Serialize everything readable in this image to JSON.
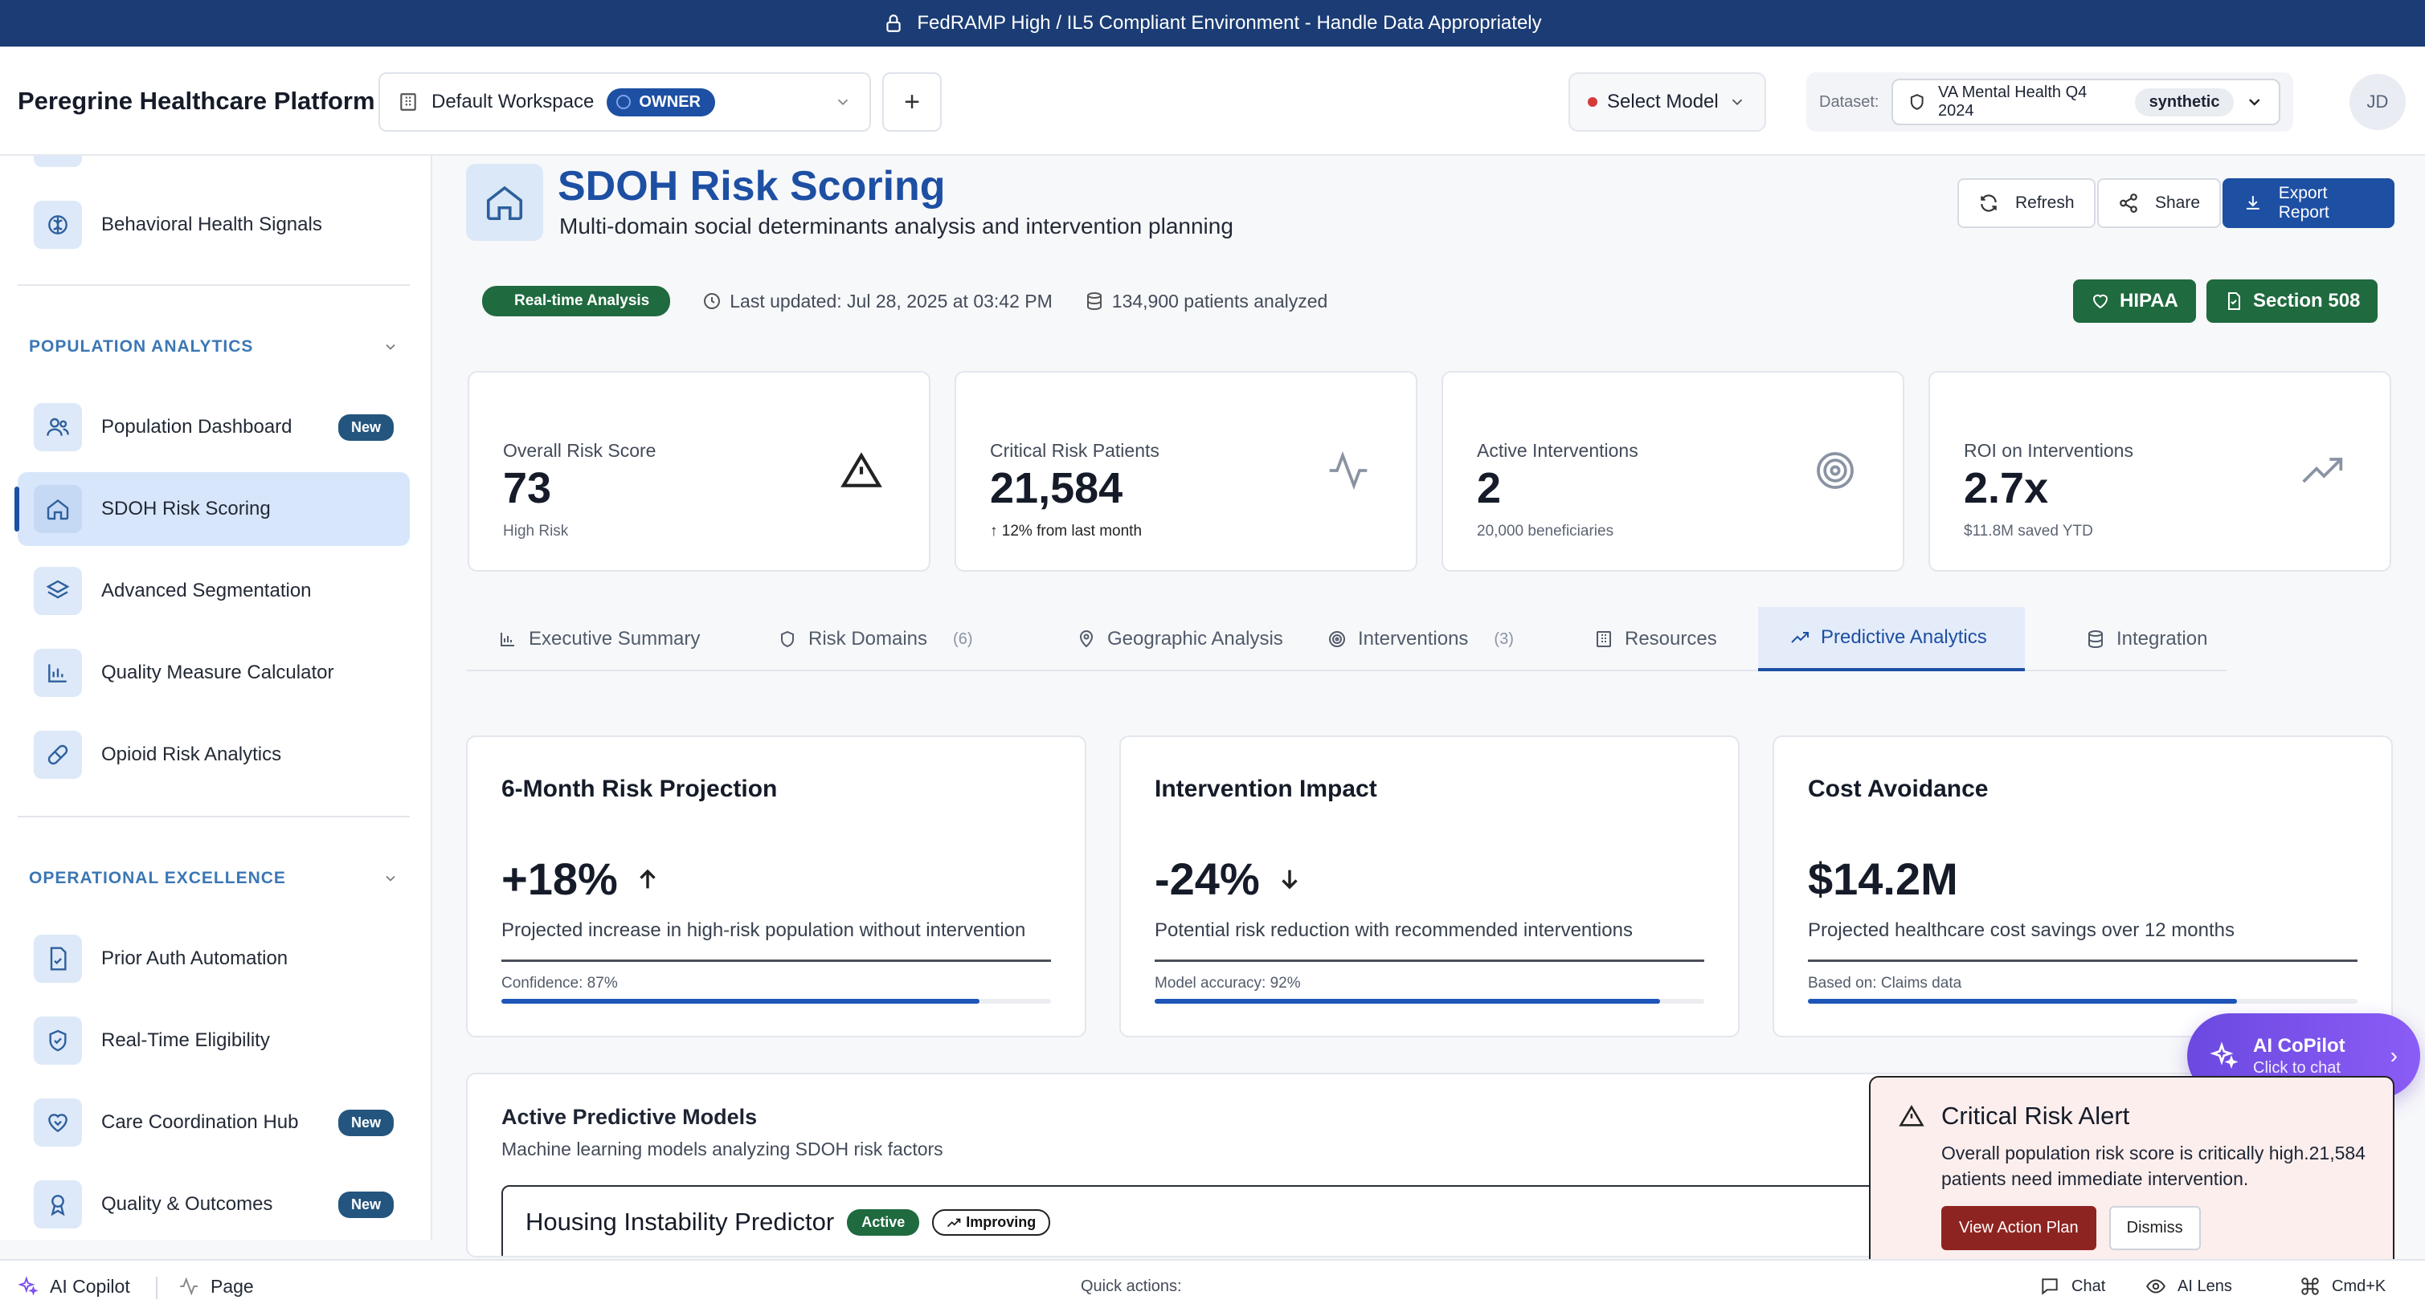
{
  "banner": {
    "text": "FedRAMP High / IL5 Compliant Environment - Handle Data Appropriately"
  },
  "header": {
    "brand": "Peregrine Healthcare Platform",
    "workspace": {
      "name": "Default Workspace",
      "role": "OWNER"
    },
    "add_label": "+",
    "model_select": "Select Model",
    "dataset": {
      "label": "Dataset:",
      "name": "VA Mental Health Q4 2024",
      "tag": "synthetic"
    },
    "avatar": "JD"
  },
  "sidebar": {
    "top_items": [
      {
        "label": "Behavioral Health Signals",
        "icon": "brain-icon"
      }
    ],
    "sections": [
      {
        "title": "POPULATION ANALYTICS",
        "items": [
          {
            "label": "Population Dashboard",
            "badge": "New",
            "icon": "users-icon"
          },
          {
            "label": "SDOH Risk Scoring",
            "badge": "",
            "icon": "home-icon",
            "active": true
          },
          {
            "label": "Advanced Segmentation",
            "badge": "",
            "icon": "layers-icon"
          },
          {
            "label": "Quality Measure Calculator",
            "badge": "",
            "icon": "bar-chart-icon"
          },
          {
            "label": "Opioid Risk Analytics",
            "badge": "",
            "icon": "pill-icon"
          }
        ]
      },
      {
        "title": "OPERATIONAL EXCELLENCE",
        "items": [
          {
            "label": "Prior Auth Automation",
            "badge": "",
            "icon": "file-check-icon"
          },
          {
            "label": "Real-Time Eligibility",
            "badge": "",
            "icon": "shield-check-icon"
          },
          {
            "label": "Care Coordination Hub",
            "badge": "New",
            "icon": "heart-handshake-icon"
          },
          {
            "label": "Quality & Outcomes",
            "badge": "New",
            "icon": "award-icon"
          }
        ]
      }
    ]
  },
  "page": {
    "title": "SDOH Risk Scoring",
    "subtitle": "Multi-domain social determinants analysis and intervention planning",
    "actions": {
      "refresh": "Refresh",
      "share": "Share",
      "export": "Export Report"
    },
    "meta": {
      "realtime": "Real-time Analysis",
      "updated": "Last updated: Jul 28, 2025 at 03:42 PM",
      "patients": "134,900 patients analyzed"
    },
    "compliance": {
      "hipaa": "HIPAA",
      "section508": "Section 508"
    }
  },
  "kpis": [
    {
      "label": "Overall Risk Score",
      "value": "73",
      "sub": "High Risk",
      "icon": "alert-triangle-icon"
    },
    {
      "label": "Critical Risk Patients",
      "value": "21,584",
      "sub": "12% from last month",
      "icon": "activity-icon"
    },
    {
      "label": "Active Interventions",
      "value": "2",
      "sub": "20,000 beneficiaries",
      "icon": "target-icon"
    },
    {
      "label": "ROI on Interventions",
      "value": "2.7x",
      "sub": "$11.8M saved YTD",
      "icon": "trending-up-icon"
    }
  ],
  "tabs": [
    {
      "label": "Executive Summary",
      "count": "",
      "icon": "bar-chart-icon"
    },
    {
      "label": "Risk Domains",
      "count": "(6)",
      "icon": "shield-icon"
    },
    {
      "label": "Geographic Analysis",
      "count": "",
      "icon": "map-pin-icon"
    },
    {
      "label": "Interventions",
      "count": "(3)",
      "icon": "target-icon"
    },
    {
      "label": "Resources",
      "count": "",
      "icon": "building-icon"
    },
    {
      "label": "Predictive Analytics",
      "count": "",
      "icon": "trending-up-icon",
      "active": true
    },
    {
      "label": "Integration",
      "count": "",
      "icon": "database-icon"
    }
  ],
  "predictions": [
    {
      "title": "6-Month Risk Projection",
      "value": "+18%",
      "desc": "Projected increase in high-risk population without intervention",
      "foot": "Confidence: 87%",
      "progress": 0.87
    },
    {
      "title": "Intervention Impact",
      "value": "-24%",
      "desc": "Potential risk reduction with recommended interventions",
      "foot": "Model accuracy: 92%",
      "progress": 0.92
    },
    {
      "title": "Cost Avoidance",
      "value": "$14.2M",
      "desc": "Projected healthcare cost savings over 12 months",
      "foot": "Based on: Claims data",
      "progress": 0.78
    }
  ],
  "models": {
    "title": "Active Predictive Models",
    "subtitle": "Machine learning models analyzing SDOH risk factors",
    "first": {
      "name": "Housing Instability Predictor",
      "status": "Active",
      "trend": "Improving"
    }
  },
  "alert": {
    "title": "Critical Risk Alert",
    "body": "Overall population risk score is critically high.21,584 patients need immediate intervention.",
    "primary": "View Action Plan",
    "secondary": "Dismiss"
  },
  "copilot": {
    "title": "AI CoPilot",
    "subtitle": "Click to chat"
  },
  "footer": {
    "copilot": "AI Copilot",
    "page": "Page",
    "quick": "Quick actions:",
    "chat": "Chat",
    "lens": "AI Lens",
    "shortcut": "Cmd+K"
  },
  "colors": {
    "brand_blue": "#1d4fa3",
    "banner": "#1b3c74",
    "success": "#1f6a3f",
    "danger": "#8e2421",
    "copilot": "#7c4ff0"
  }
}
